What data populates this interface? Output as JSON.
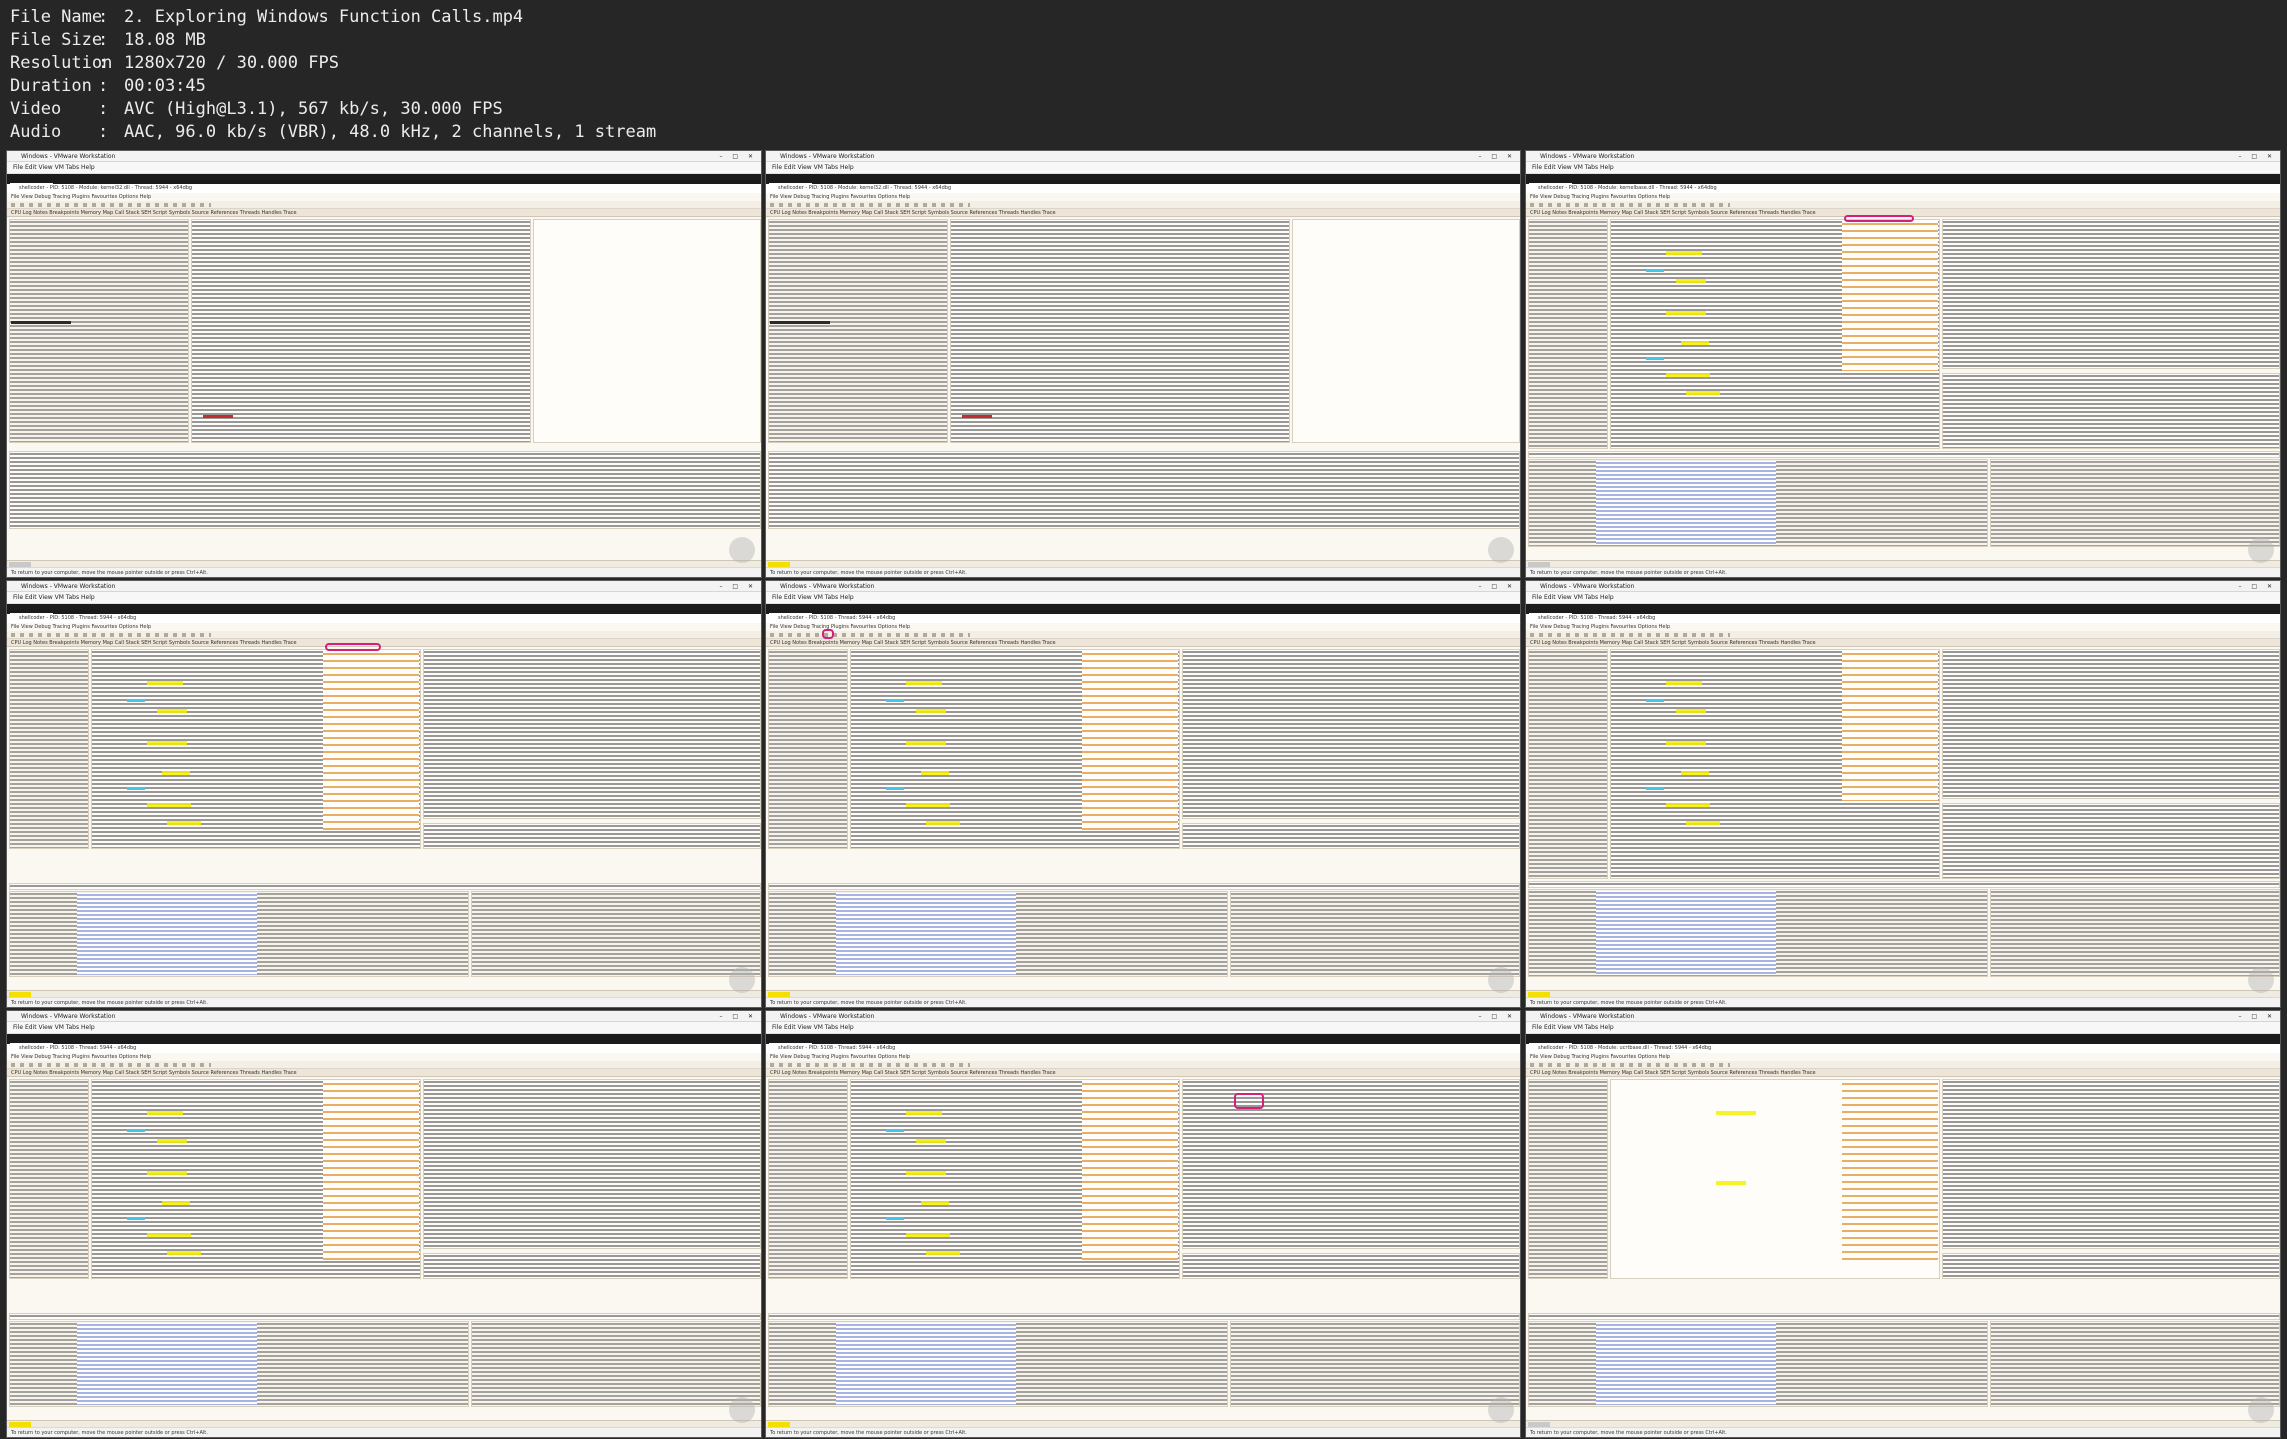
{
  "media_info": {
    "rows": [
      {
        "key": "File Name",
        "value": "2. Exploring Windows Function Calls.mp4"
      },
      {
        "key": "File Size",
        "value": "18.08 MB"
      },
      {
        "key": "Resolution",
        "value": "1280x720 / 30.000 FPS"
      },
      {
        "key": "Duration",
        "value": "00:03:45"
      },
      {
        "key": "Video",
        "value": "AVC (High@L3.1), 567 kb/s, 30.000 FPS"
      },
      {
        "key": "Audio",
        "value": "AAC, 96.0 kb/s (VBR), 48.0 kHz, 2 channels, 1 stream"
      }
    ],
    "separator": ":"
  },
  "thumbnails": [
    {
      "vm_title": "Windows - VMware Workstation",
      "vm_tab": "Windows",
      "debugger_title": "shellcoder - PID: 5108 - Module: kernel32.dll - Thread: 5944 - x64dbg"
    },
    {
      "vm_title": "Windows - VMware Workstation",
      "vm_tab": "Windows",
      "debugger_title": "shellcoder - PID: 5108 - Module: kernel32.dll - Thread: 5944 - x64dbg"
    },
    {
      "vm_title": "Windows - VMware Workstation",
      "vm_tab": "Windows",
      "debugger_title": "shellcoder - PID: 5108 - Module: kernelbase.dll - Thread: 5944 - x64dbg"
    },
    {
      "vm_title": "Windows - VMware Workstation",
      "vm_tab": "Windows",
      "debugger_title": "shellcoder - PID: 5108 - Thread: 5944 - x64dbg"
    },
    {
      "vm_title": "Windows - VMware Workstation",
      "vm_tab": "Windows",
      "debugger_title": "shellcoder - PID: 5108 - Thread: 5944 - x64dbg"
    },
    {
      "vm_title": "Windows - VMware Workstation",
      "vm_tab": "Windows",
      "debugger_title": "shellcoder - PID: 5108 - Thread: 5944 - x64dbg"
    },
    {
      "vm_title": "Windows - VMware Workstation",
      "vm_tab": "Windows",
      "debugger_title": "shellcoder - PID: 5108 - Thread: 5944 - x64dbg"
    },
    {
      "vm_title": "Windows - VMware Workstation",
      "vm_tab": "Windows",
      "debugger_title": "shellcoder - PID: 5108 - Thread: 5944 - x64dbg"
    },
    {
      "vm_title": "Windows - VMware Workstation",
      "vm_tab": "Windows",
      "debugger_title": "shellcoder - PID: 5108 - Module: ucrtbase.dll - Thread: 5944 - x64dbg"
    }
  ],
  "vm_menu": "File   Edit   View   VM   Tabs   Help",
  "dbg_menu": "File  View  Debug  Tracing  Plugins  Favourites  Options  Help",
  "dbg_tabs": "CPU   Log   Notes   Breakpoints   Memory Map   Call Stack   SEH   Script   Symbols   Source   References   Threads   Handles   Trace",
  "vm_status_text": "To return to your computer, move the mouse pointer outside or press Ctrl+Alt.",
  "colors": {
    "highlight": "#f4f000",
    "annotation": "#d4207a",
    "paused_badge": "#f4e000"
  }
}
